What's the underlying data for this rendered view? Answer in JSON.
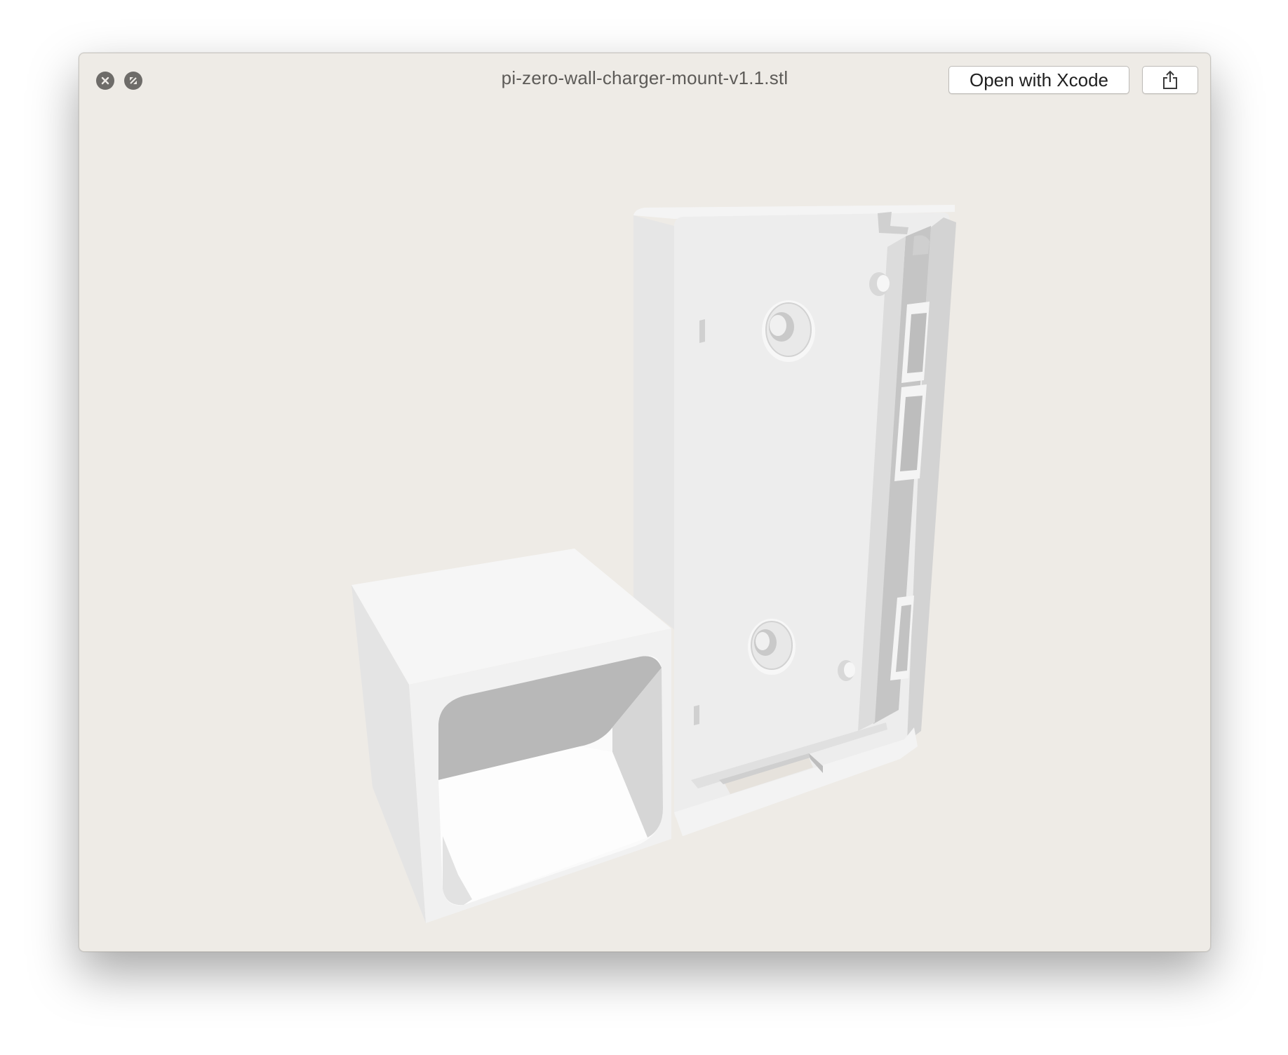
{
  "window": {
    "title": "pi-zero-wall-charger-mount-v1.1.stl",
    "background_color": "#eeebe6"
  },
  "toolbar": {
    "close_icon": "close-icon",
    "fullscreen_icon": "fullscreen-icon",
    "open_with_label": "Open with Xcode",
    "share_icon": "share-icon"
  },
  "viewer": {
    "model_name": "3d-model-render",
    "model_color": "#f2f2f2"
  }
}
